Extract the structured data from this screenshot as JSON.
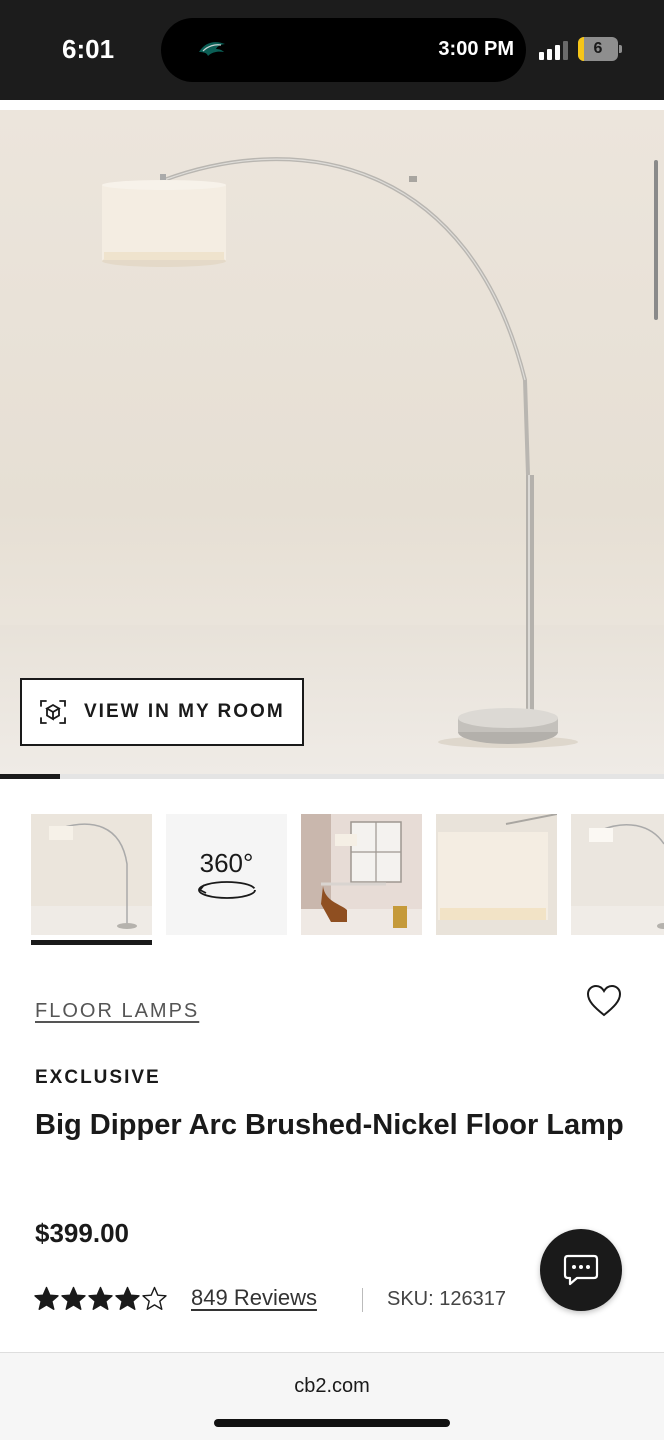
{
  "status_bar": {
    "time": "6:01",
    "island_time": "3:00 PM",
    "battery_level": "6",
    "battery_fraction": 0.15,
    "signal_bars": 3
  },
  "hero": {
    "view_in_room_label": "VIEW IN MY ROOM",
    "gallery_progress": 0.09
  },
  "gallery": {
    "thumbnails": [
      {
        "name": "arc-lamp-front"
      },
      {
        "name": "360-view",
        "label": "360°"
      },
      {
        "name": "lamp-in-room"
      },
      {
        "name": "lamp-shade-closeup"
      },
      {
        "name": "arc-lamp-angle"
      }
    ],
    "active_index": 0
  },
  "product": {
    "category": "FLOOR LAMPS",
    "badge": "EXCLUSIVE",
    "title": "Big Dipper Arc Brushed-Nickel Floor Lamp",
    "price": "$399.00",
    "rating": 4.5,
    "rating_max": 5,
    "reviews_label": "849 Reviews",
    "sku_label": "SKU: 126317"
  },
  "browser": {
    "url": "cb2.com"
  },
  "colors": {
    "dark": "#1c1c1c",
    "battery_fill": "#f5c518",
    "hero_background": "#e8e1d7"
  }
}
